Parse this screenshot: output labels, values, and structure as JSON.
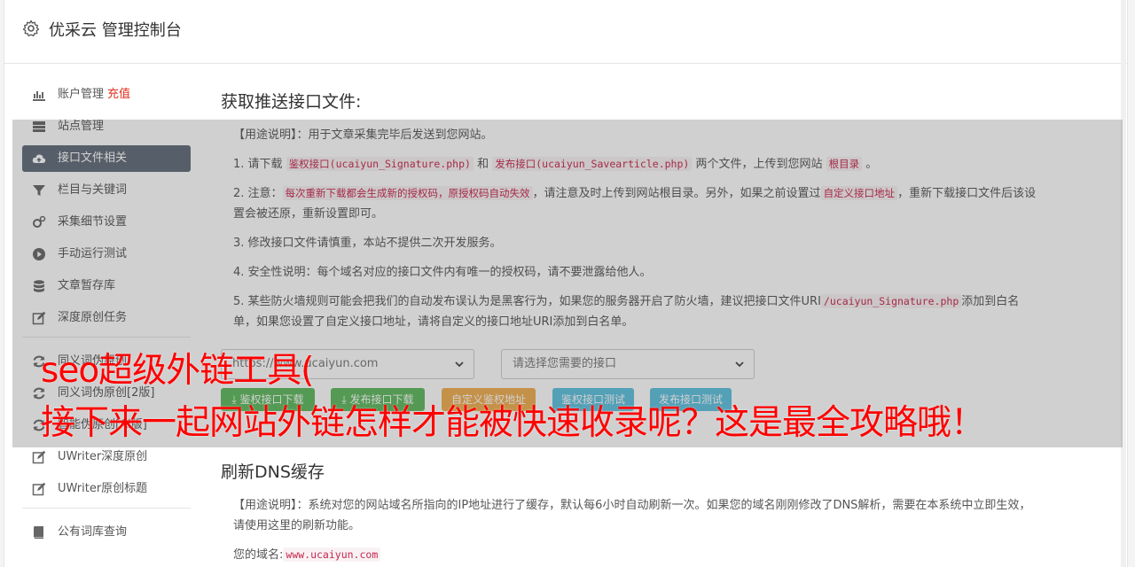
{
  "header": {
    "title": "优采云 管理控制台",
    "icon": "gear-icon"
  },
  "sidebar": {
    "recharge_label": "充值",
    "items": [
      {
        "label": "账户管理",
        "icon": "bar-chart-icon"
      },
      {
        "label": "站点管理",
        "icon": "server-icon"
      },
      {
        "label": "接口文件相关",
        "icon": "cloud-upload-icon"
      },
      {
        "label": "栏目与关键词",
        "icon": "filter-icon"
      },
      {
        "label": "采集细节设置",
        "icon": "cogs-icon"
      },
      {
        "label": "手动运行测试",
        "icon": "play-circle-icon"
      },
      {
        "label": "文章暂存库",
        "icon": "database-icon"
      },
      {
        "label": "深度原创任务",
        "icon": "edit-icon"
      }
    ],
    "items2": [
      {
        "label": "同义词伪原创",
        "icon": "refresh-icon"
      },
      {
        "label": "同义词伪原创[2版]",
        "icon": "refresh-icon"
      },
      {
        "label": "智能伪原创[AI版]",
        "icon": "refresh-icon"
      },
      {
        "label": "UWriter深度原创",
        "icon": "edit-icon"
      },
      {
        "label": "UWriter原创标题",
        "icon": "edit-icon"
      }
    ],
    "items3": [
      {
        "label": "公有词库查询",
        "icon": "book-icon"
      }
    ]
  },
  "main": {
    "title": "获取推送接口文件:",
    "usage": "【用途说明】：用于文章采集完毕后发送到您网站。",
    "p1": {
      "a": "1. 请下载",
      "code1": "鉴权接口(ucaiyun_Signature.php)",
      "b": "和",
      "code2": "发布接口(ucaiyun_Savearticle.php)",
      "c": "两个文件，上传到您网站",
      "code3": "根目录",
      "d": "。"
    },
    "p2": {
      "a": "2. 注意：",
      "code1": "每次重新下载都会生成新的授权码，原授权码自动失效",
      "b": "，请注意及时上传到网站根目录。另外，如果之前设置过",
      "code2": "自定义接口地址",
      "c": "，重新下载接口文件后该设置会被还原，重新设置即可。"
    },
    "p3": "3. 修改接口文件请慎重，本站不提供二次开发服务。",
    "p4": "4. 安全性说明：每个域名对应的接口文件内有唯一的授权码，请不要泄露给他人。",
    "p5": {
      "a": "5. 某些防火墙规则可能会把我们的自动发布误认为是黑客行为，如果您的服务器开启了防火墙，建议把接口文件URI",
      "code1": "/ucaiyun_Signature.php",
      "b": "添加到白名单，如果您设置了自定义接口地址，请将自定义的接口地址URI添加到白名单。"
    },
    "select_site": "https://www.ucaiyun.com",
    "select_api": "请选择您需要的接口",
    "buttons": {
      "download_auth": "鉴权接口下载",
      "download_publish": "发布接口下载",
      "custom_auth": "自定义鉴权地址",
      "test_auth": "鉴权接口测试",
      "test_publish": "发布接口测试"
    }
  },
  "dns": {
    "title": "刷新DNS缓存",
    "usage": "【用途说明】：系统对您的网站域名所指向的IP地址进行了缓存，默认每6小时自动刷新一次。如果您的域名刚刚修改了DNS解析，需要在本系统中立即生效，请使用这里的刷新功能。",
    "domain_label": "您的域名:",
    "domain_value": "www.ucaiyun.com"
  },
  "ad": {
    "line1": "seo超级外链工具(",
    "line2": "接下来一起网站外链怎样才能被快速收录呢？这是最全攻略哦！"
  },
  "colors": {
    "active_nav": "#5f6b78",
    "green": "#5cb85c",
    "orange": "#f0ad4e",
    "blue": "#5bc0de",
    "ad_red": "#ff0000"
  }
}
